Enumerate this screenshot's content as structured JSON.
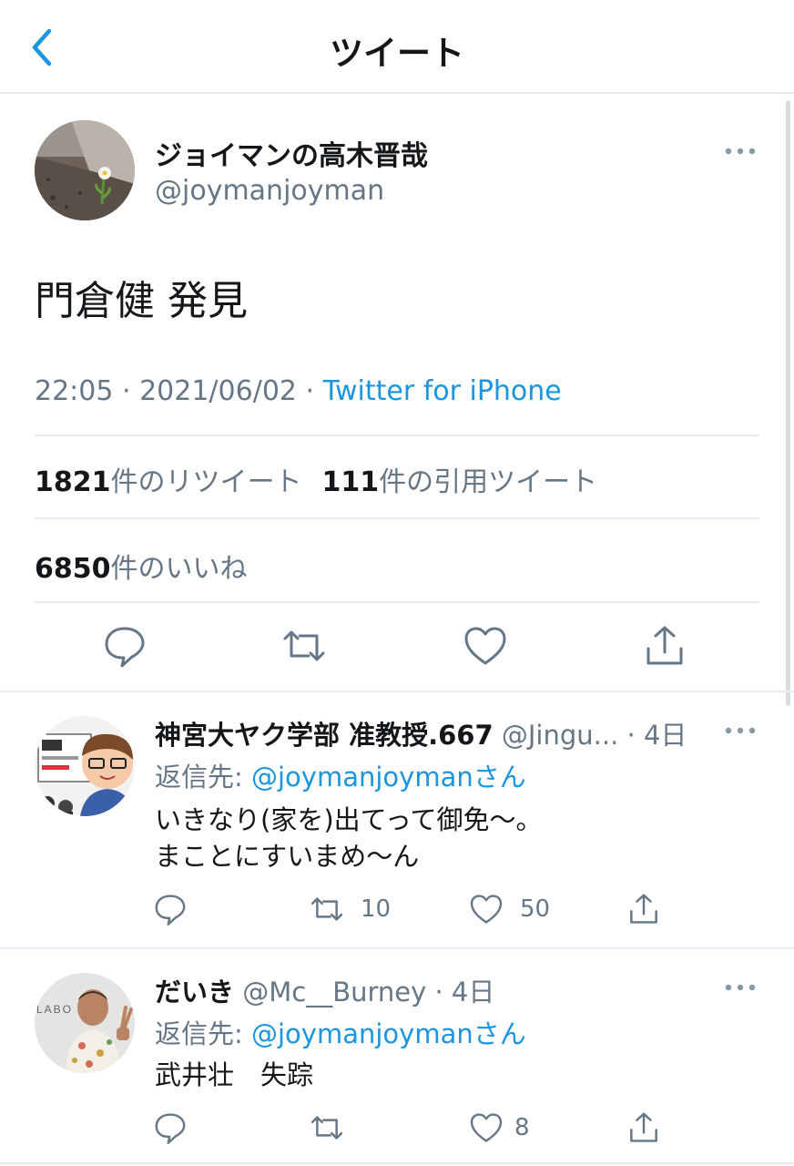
{
  "header": {
    "title": "ツイート",
    "back_icon": "chevron-left-icon"
  },
  "colors": {
    "accent": "#1b95e0",
    "secondary_text": "#657786",
    "primary_text": "#14171a",
    "divider": "#e6ecf0"
  },
  "tweet": {
    "author_name": "ジョイマンの高木晋哉",
    "author_handle": "@joymanjoyman",
    "text": "門倉健 発見",
    "time": "22:05",
    "date": "2021/06/02",
    "source": "Twitter for iPhone",
    "sep": " · ",
    "retweets_count": "1821",
    "retweets_label": "件のリツイート",
    "quotes_count": "111",
    "quotes_label": "件の引用ツイート",
    "likes_count": "6850",
    "likes_label": "件のいいね"
  },
  "replies": [
    {
      "name": "神宮大ヤク学部 准教授.667",
      "handle": "@Jingu...",
      "time": "· 4日",
      "reply_to_label": "返信先: ",
      "reply_to_mention": "@joymanjoymanさん",
      "text_lines": [
        "いきなり(家を)出てって御免〜。",
        "まことにすいまめ〜ん"
      ],
      "retweet_count": "10",
      "like_count": "50"
    },
    {
      "name": "だいき",
      "handle": "@Mc__Burney",
      "time": "· 4日",
      "reply_to_label": "返信先: ",
      "reply_to_mention": "@joymanjoymanさん",
      "text_lines": [
        "武井壮　失踪"
      ],
      "retweet_count": "",
      "like_count": "8"
    }
  ]
}
